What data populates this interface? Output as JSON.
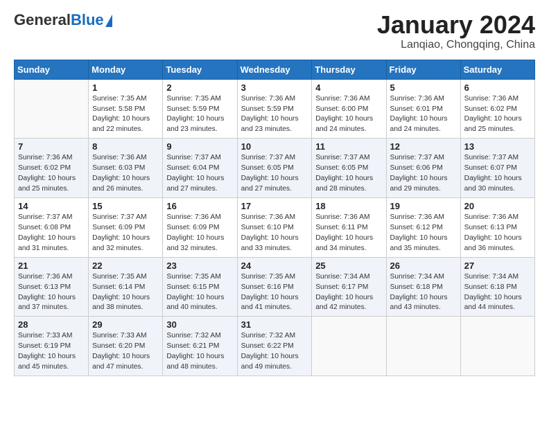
{
  "header": {
    "logo_general": "General",
    "logo_blue": "Blue",
    "title": "January 2024",
    "subtitle": "Lanqiao, Chongqing, China"
  },
  "weekdays": [
    "Sunday",
    "Monday",
    "Tuesday",
    "Wednesday",
    "Thursday",
    "Friday",
    "Saturday"
  ],
  "weeks": [
    [
      {
        "day": "",
        "info": ""
      },
      {
        "day": "1",
        "info": "Sunrise: 7:35 AM\nSunset: 5:58 PM\nDaylight: 10 hours\nand 22 minutes."
      },
      {
        "day": "2",
        "info": "Sunrise: 7:35 AM\nSunset: 5:59 PM\nDaylight: 10 hours\nand 23 minutes."
      },
      {
        "day": "3",
        "info": "Sunrise: 7:36 AM\nSunset: 5:59 PM\nDaylight: 10 hours\nand 23 minutes."
      },
      {
        "day": "4",
        "info": "Sunrise: 7:36 AM\nSunset: 6:00 PM\nDaylight: 10 hours\nand 24 minutes."
      },
      {
        "day": "5",
        "info": "Sunrise: 7:36 AM\nSunset: 6:01 PM\nDaylight: 10 hours\nand 24 minutes."
      },
      {
        "day": "6",
        "info": "Sunrise: 7:36 AM\nSunset: 6:02 PM\nDaylight: 10 hours\nand 25 minutes."
      }
    ],
    [
      {
        "day": "7",
        "info": "Sunrise: 7:36 AM\nSunset: 6:02 PM\nDaylight: 10 hours\nand 25 minutes."
      },
      {
        "day": "8",
        "info": "Sunrise: 7:36 AM\nSunset: 6:03 PM\nDaylight: 10 hours\nand 26 minutes."
      },
      {
        "day": "9",
        "info": "Sunrise: 7:37 AM\nSunset: 6:04 PM\nDaylight: 10 hours\nand 27 minutes."
      },
      {
        "day": "10",
        "info": "Sunrise: 7:37 AM\nSunset: 6:05 PM\nDaylight: 10 hours\nand 27 minutes."
      },
      {
        "day": "11",
        "info": "Sunrise: 7:37 AM\nSunset: 6:05 PM\nDaylight: 10 hours\nand 28 minutes."
      },
      {
        "day": "12",
        "info": "Sunrise: 7:37 AM\nSunset: 6:06 PM\nDaylight: 10 hours\nand 29 minutes."
      },
      {
        "day": "13",
        "info": "Sunrise: 7:37 AM\nSunset: 6:07 PM\nDaylight: 10 hours\nand 30 minutes."
      }
    ],
    [
      {
        "day": "14",
        "info": "Sunrise: 7:37 AM\nSunset: 6:08 PM\nDaylight: 10 hours\nand 31 minutes."
      },
      {
        "day": "15",
        "info": "Sunrise: 7:37 AM\nSunset: 6:09 PM\nDaylight: 10 hours\nand 32 minutes."
      },
      {
        "day": "16",
        "info": "Sunrise: 7:36 AM\nSunset: 6:09 PM\nDaylight: 10 hours\nand 32 minutes."
      },
      {
        "day": "17",
        "info": "Sunrise: 7:36 AM\nSunset: 6:10 PM\nDaylight: 10 hours\nand 33 minutes."
      },
      {
        "day": "18",
        "info": "Sunrise: 7:36 AM\nSunset: 6:11 PM\nDaylight: 10 hours\nand 34 minutes."
      },
      {
        "day": "19",
        "info": "Sunrise: 7:36 AM\nSunset: 6:12 PM\nDaylight: 10 hours\nand 35 minutes."
      },
      {
        "day": "20",
        "info": "Sunrise: 7:36 AM\nSunset: 6:13 PM\nDaylight: 10 hours\nand 36 minutes."
      }
    ],
    [
      {
        "day": "21",
        "info": "Sunrise: 7:36 AM\nSunset: 6:13 PM\nDaylight: 10 hours\nand 37 minutes."
      },
      {
        "day": "22",
        "info": "Sunrise: 7:35 AM\nSunset: 6:14 PM\nDaylight: 10 hours\nand 38 minutes."
      },
      {
        "day": "23",
        "info": "Sunrise: 7:35 AM\nSunset: 6:15 PM\nDaylight: 10 hours\nand 40 minutes."
      },
      {
        "day": "24",
        "info": "Sunrise: 7:35 AM\nSunset: 6:16 PM\nDaylight: 10 hours\nand 41 minutes."
      },
      {
        "day": "25",
        "info": "Sunrise: 7:34 AM\nSunset: 6:17 PM\nDaylight: 10 hours\nand 42 minutes."
      },
      {
        "day": "26",
        "info": "Sunrise: 7:34 AM\nSunset: 6:18 PM\nDaylight: 10 hours\nand 43 minutes."
      },
      {
        "day": "27",
        "info": "Sunrise: 7:34 AM\nSunset: 6:18 PM\nDaylight: 10 hours\nand 44 minutes."
      }
    ],
    [
      {
        "day": "28",
        "info": "Sunrise: 7:33 AM\nSunset: 6:19 PM\nDaylight: 10 hours\nand 45 minutes."
      },
      {
        "day": "29",
        "info": "Sunrise: 7:33 AM\nSunset: 6:20 PM\nDaylight: 10 hours\nand 47 minutes."
      },
      {
        "day": "30",
        "info": "Sunrise: 7:32 AM\nSunset: 6:21 PM\nDaylight: 10 hours\nand 48 minutes."
      },
      {
        "day": "31",
        "info": "Sunrise: 7:32 AM\nSunset: 6:22 PM\nDaylight: 10 hours\nand 49 minutes."
      },
      {
        "day": "",
        "info": ""
      },
      {
        "day": "",
        "info": ""
      },
      {
        "day": "",
        "info": ""
      }
    ]
  ]
}
